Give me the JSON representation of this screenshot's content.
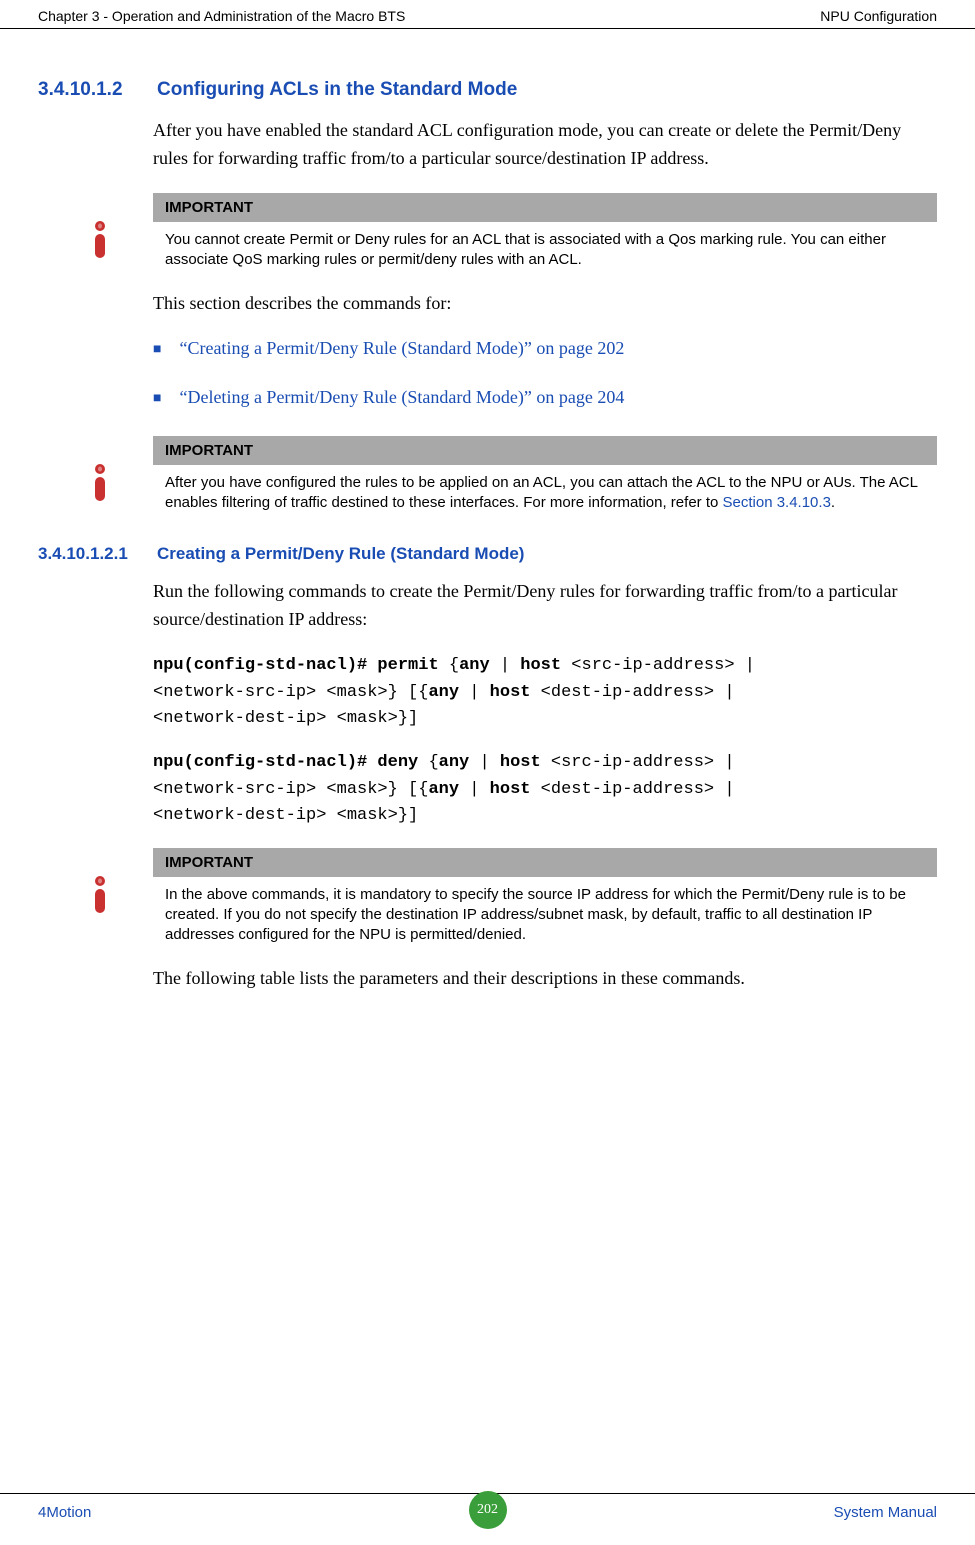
{
  "header": {
    "left": "Chapter 3 - Operation and Administration of the Macro BTS",
    "right": "NPU Configuration"
  },
  "section1": {
    "number": "3.4.10.1.2",
    "title": "Configuring ACLs in the Standard Mode",
    "intro": "After you have enabled the standard ACL configuration mode, you can create or delete the Permit/Deny rules for forwarding traffic from/to a particular source/destination IP address.",
    "important1": {
      "label": "IMPORTANT",
      "text": "You cannot create Permit or Deny rules for an ACL that is associated with a Qos marking rule. You can either associate QoS marking rules or permit/deny rules with an ACL."
    },
    "describes": "This section describes the commands for:",
    "bullets": [
      "“Creating a Permit/Deny Rule (Standard Mode)” on page 202",
      "“Deleting a Permit/Deny Rule (Standard Mode)” on page 204"
    ],
    "important2": {
      "label": "IMPORTANT",
      "text_before": "After you have configured the rules to be applied on an ACL, you can attach the ACL to the NPU or AUs. The ACL enables filtering of traffic destined to these interfaces. For more information, refer to ",
      "link": "Section 3.4.10.3",
      "text_after": "."
    }
  },
  "section2": {
    "number": "3.4.10.1.2.1",
    "title": "Creating a Permit/Deny Rule (Standard Mode)",
    "intro": "Run the following commands to create the Permit/Deny rules for forwarding traffic from/to a particular source/destination IP address:",
    "code1": {
      "l1a": "npu(config-std-nacl)# permit ",
      "l1b": "{",
      "l1c": "any",
      "l1d": " | ",
      "l1e": "host",
      "l1f": " <src-ip-address> | ",
      "l2a": "<network-src-ip> <mask>} [{",
      "l2b": "any",
      "l2c": " | ",
      "l2d": "host",
      "l2e": " <dest-ip-address> | ",
      "l3a": "<network-dest-ip> <mask>}]"
    },
    "code2": {
      "l1a": "npu(config-std-nacl)# deny ",
      "l1b": "{",
      "l1c": "any",
      "l1d": " | ",
      "l1e": "host",
      "l1f": " <src-ip-address> | ",
      "l2a": "<network-src-ip> <mask>} [{",
      "l2b": "any",
      "l2c": " | ",
      "l2d": "host",
      "l2e": " <dest-ip-address> | ",
      "l3a": "<network-dest-ip> <mask>}]"
    },
    "important3": {
      "label": "IMPORTANT",
      "text": "In the above commands, it is mandatory to specify the source IP address for which the Permit/Deny rule is to be created. If you do not specify the destination IP address/subnet mask, by default, traffic to all destination IP addresses configured for the NPU is permitted/denied."
    },
    "outro": "The following table lists the parameters and their descriptions in these commands."
  },
  "footer": {
    "left": "4Motion",
    "page": "202",
    "right": "System Manual"
  }
}
